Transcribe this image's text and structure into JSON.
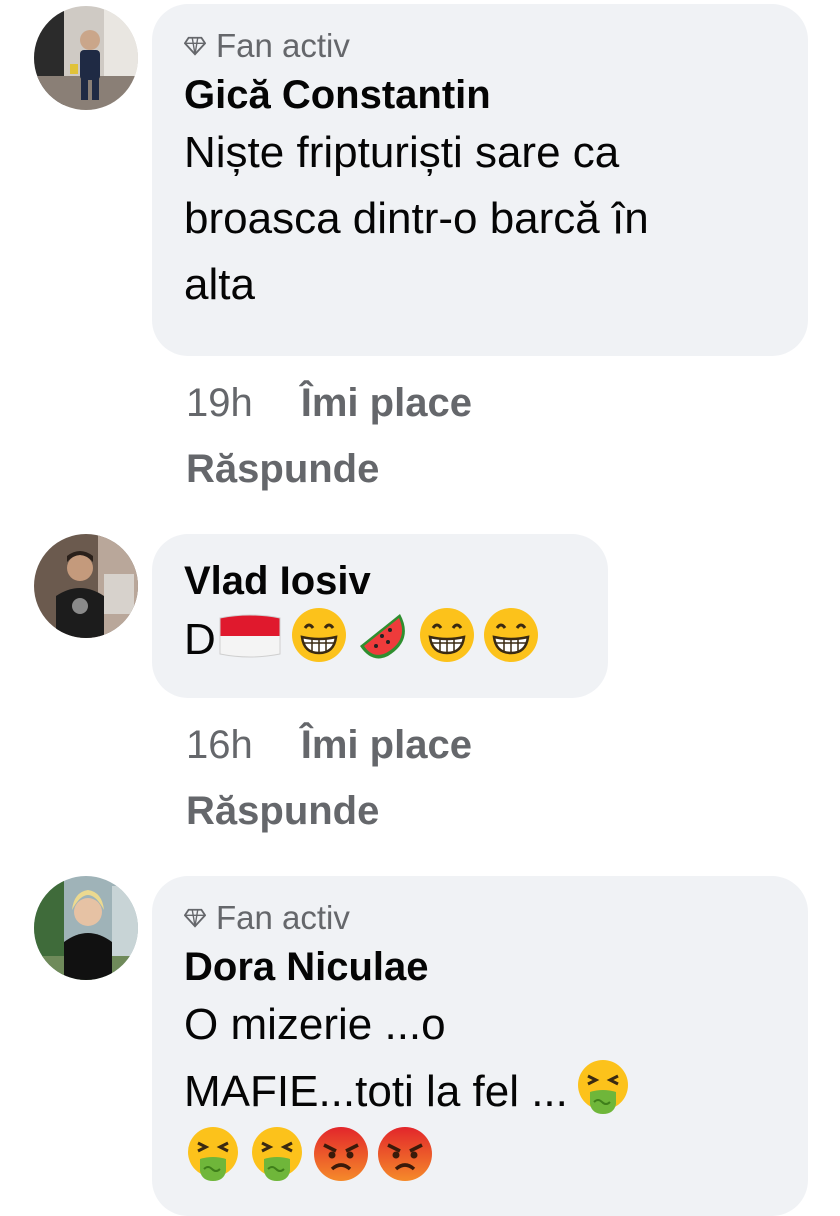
{
  "comments": [
    {
      "badge": "Fan activ",
      "author": "Gică Constantin",
      "text_lines": [
        "Niște fripturiști sare ca",
        "broasca dintr-o barcă în",
        "alta"
      ],
      "time": "19h",
      "like": "Îmi place",
      "reply": "Răspunde"
    },
    {
      "author": "Vlad Iosiv",
      "text_prefix": "D",
      "emojis": [
        "flag-indonesia-icon",
        "grinning-face-icon",
        "watermelon-icon",
        "grinning-face-icon",
        "grinning-face-icon"
      ],
      "time": "16h",
      "like": "Îmi place",
      "reply": "Răspunde"
    },
    {
      "badge": "Fan activ",
      "author": "Dora Niculae",
      "text_lines": [
        "O mizerie ...o",
        "MAFIE...toti la fel ..."
      ],
      "emojis_line2": [
        "vomiting-face-icon"
      ],
      "emojis_line3": [
        "vomiting-face-icon",
        "vomiting-face-icon",
        "angry-face-icon",
        "angry-face-icon"
      ]
    }
  ],
  "colors": {
    "bubble": "#f0f2f5",
    "secondary_text": "#65676b",
    "primary_text": "#050505"
  }
}
